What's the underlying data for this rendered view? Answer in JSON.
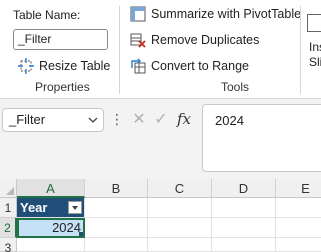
{
  "ribbon": {
    "properties": {
      "table_name_label": "Table Name:",
      "table_name_value": "_Filter",
      "resize_label": "Resize Table",
      "group_label": "Properties"
    },
    "tools": {
      "pivot_label": "Summarize with PivotTable",
      "remove_dup_label": "Remove Duplicates",
      "convert_label": "Convert to Range",
      "group_label": "Tools"
    },
    "slicer": {
      "line1": "Ins",
      "line2": "Sli"
    }
  },
  "formula_bar": {
    "name_box": "_Filter",
    "fx_symbol": "fx",
    "cancel_symbol": "✕",
    "enter_symbol": "✓",
    "formula_value": "2024"
  },
  "grid": {
    "columns": [
      "A",
      "B",
      "C",
      "D",
      "E"
    ],
    "rows": [
      "1",
      "2",
      "3"
    ],
    "header_cell": "Year",
    "data_cell": "2024"
  },
  "colors": {
    "table_header": "#1f4e79",
    "selected_cell": "#c6e0f5",
    "accent": "#217346"
  }
}
